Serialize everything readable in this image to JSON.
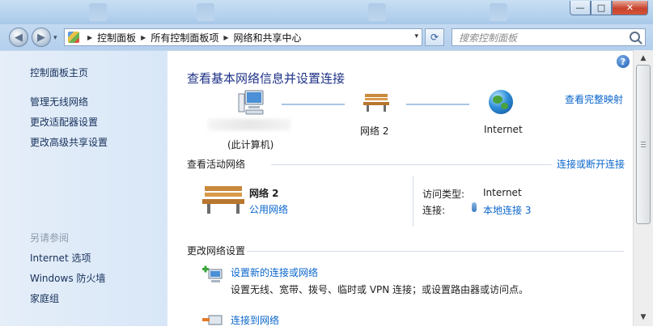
{
  "window": {
    "buttons": {
      "minimize": "—",
      "maximize": "□",
      "close": "✕"
    }
  },
  "navbar": {
    "back_glyph": "◀",
    "forward_glyph": "▶",
    "dropdown_glyph": "▾",
    "breadcrumbs": [
      "控制面板",
      "所有控制面板项",
      "网络和共享中心"
    ],
    "separator_glyph": "▶",
    "refresh_glyph": "⟳",
    "search_placeholder": "搜索控制面板"
  },
  "sidebar": {
    "links": [
      "控制面板主页",
      "管理无线网络",
      "更改适配器设置",
      "更改高级共享设置"
    ],
    "see_also_header": "另请参阅",
    "see_also_links": [
      "Internet 选项",
      "Windows 防火墙",
      "家庭组"
    ]
  },
  "main": {
    "help_glyph": "?",
    "title": "查看基本网络信息并设置连接",
    "full_map_link": "查看完整映射",
    "map": {
      "computer_label": "(此计算机)",
      "network_label": "网络  2",
      "internet_label": "Internet"
    },
    "active_networks": {
      "header": "查看活动网络",
      "connect_link": "连接或断开连接",
      "network_name": "网络  2",
      "network_category": "公用网络",
      "access_type_key": "访问类型:",
      "access_type_value": "Internet",
      "connections_key": "连接:",
      "connection_value": "本地连接 3"
    },
    "change_settings": {
      "header": "更改网络设置",
      "tasks": [
        {
          "title": "设置新的连接或网络",
          "desc": "设置无线、宽带、拨号、临时或 VPN 连接；或设置路由器或访问点。"
        },
        {
          "title": "连接到网络",
          "desc": ""
        }
      ]
    }
  },
  "scrollbar": {
    "up_glyph": "▲",
    "down_glyph": "▼"
  }
}
